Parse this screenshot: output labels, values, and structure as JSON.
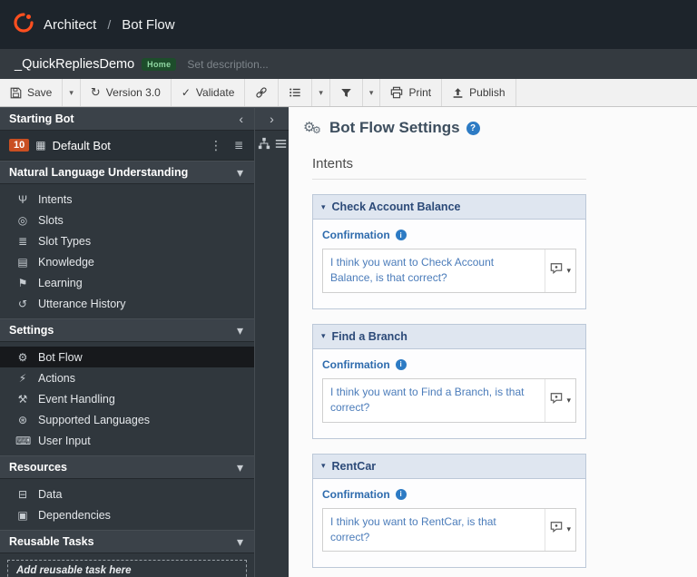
{
  "header": {
    "app": "Architect",
    "separator": "/",
    "page": "Bot Flow"
  },
  "flowbar": {
    "title": "_QuickRepliesDemo",
    "badge": "Home",
    "description": "Set description..."
  },
  "toolbar": {
    "save": "Save",
    "version": "Version 3.0",
    "validate": "Validate",
    "print": "Print",
    "publish": "Publish"
  },
  "sidebar": {
    "starting_bot_header": "Starting Bot",
    "default_bot": {
      "badge": "10",
      "label": "Default Bot"
    },
    "nlu": {
      "header": "Natural Language Understanding",
      "items": [
        {
          "label": "Intents"
        },
        {
          "label": "Slots"
        },
        {
          "label": "Slot Types"
        },
        {
          "label": "Knowledge"
        },
        {
          "label": "Learning"
        },
        {
          "label": "Utterance History"
        }
      ]
    },
    "settings": {
      "header": "Settings",
      "items": [
        {
          "label": "Bot Flow"
        },
        {
          "label": "Actions"
        },
        {
          "label": "Event Handling"
        },
        {
          "label": "Supported Languages"
        },
        {
          "label": "User Input"
        }
      ]
    },
    "resources": {
      "header": "Resources",
      "items": [
        {
          "label": "Data"
        },
        {
          "label": "Dependencies"
        }
      ]
    },
    "reusable": {
      "header": "Reusable Tasks",
      "add_placeholder": "Add reusable task here"
    }
  },
  "main": {
    "title": "Bot Flow Settings",
    "help": "?",
    "section": "Intents",
    "confirmation_label": "Confirmation",
    "intents": [
      {
        "name": "Check Account Balance",
        "confirmation": "I think you want to Check Account Balance, is that correct?"
      },
      {
        "name": "Find a Branch",
        "confirmation": "I think you want to Find a Branch, is that correct?"
      },
      {
        "name": "RentCar",
        "confirmation": "I think you want to RentCar, is that correct?"
      }
    ]
  },
  "icons": {
    "caret_down": "▾",
    "chevron_left": "‹",
    "chevron_right": "›",
    "kebab": "⋮",
    "check": "✓",
    "refresh": "↻",
    "intents": "Ψ",
    "slots": "◎",
    "slot_types": "≣",
    "knowledge": "▤",
    "learning": "⚑",
    "utterance_history": "↺",
    "bot_flow": "⚙",
    "actions": "⚡",
    "event_handling": "⚒",
    "supported_languages": "⊛",
    "user_input": "⌨",
    "data": "⊟",
    "dependencies": "▣",
    "default_bot": "▦",
    "gear": "⚙",
    "info": "i",
    "list_small": "≣"
  },
  "colors": {
    "brand_orange": "#ff4f1f",
    "badge_orange": "#c94f22",
    "accent_blue": "#2d7bc4",
    "card_header_bg": "#dfe6f0",
    "sidebar_bg": "#30373d",
    "selected_item_bg": "#17191c"
  }
}
